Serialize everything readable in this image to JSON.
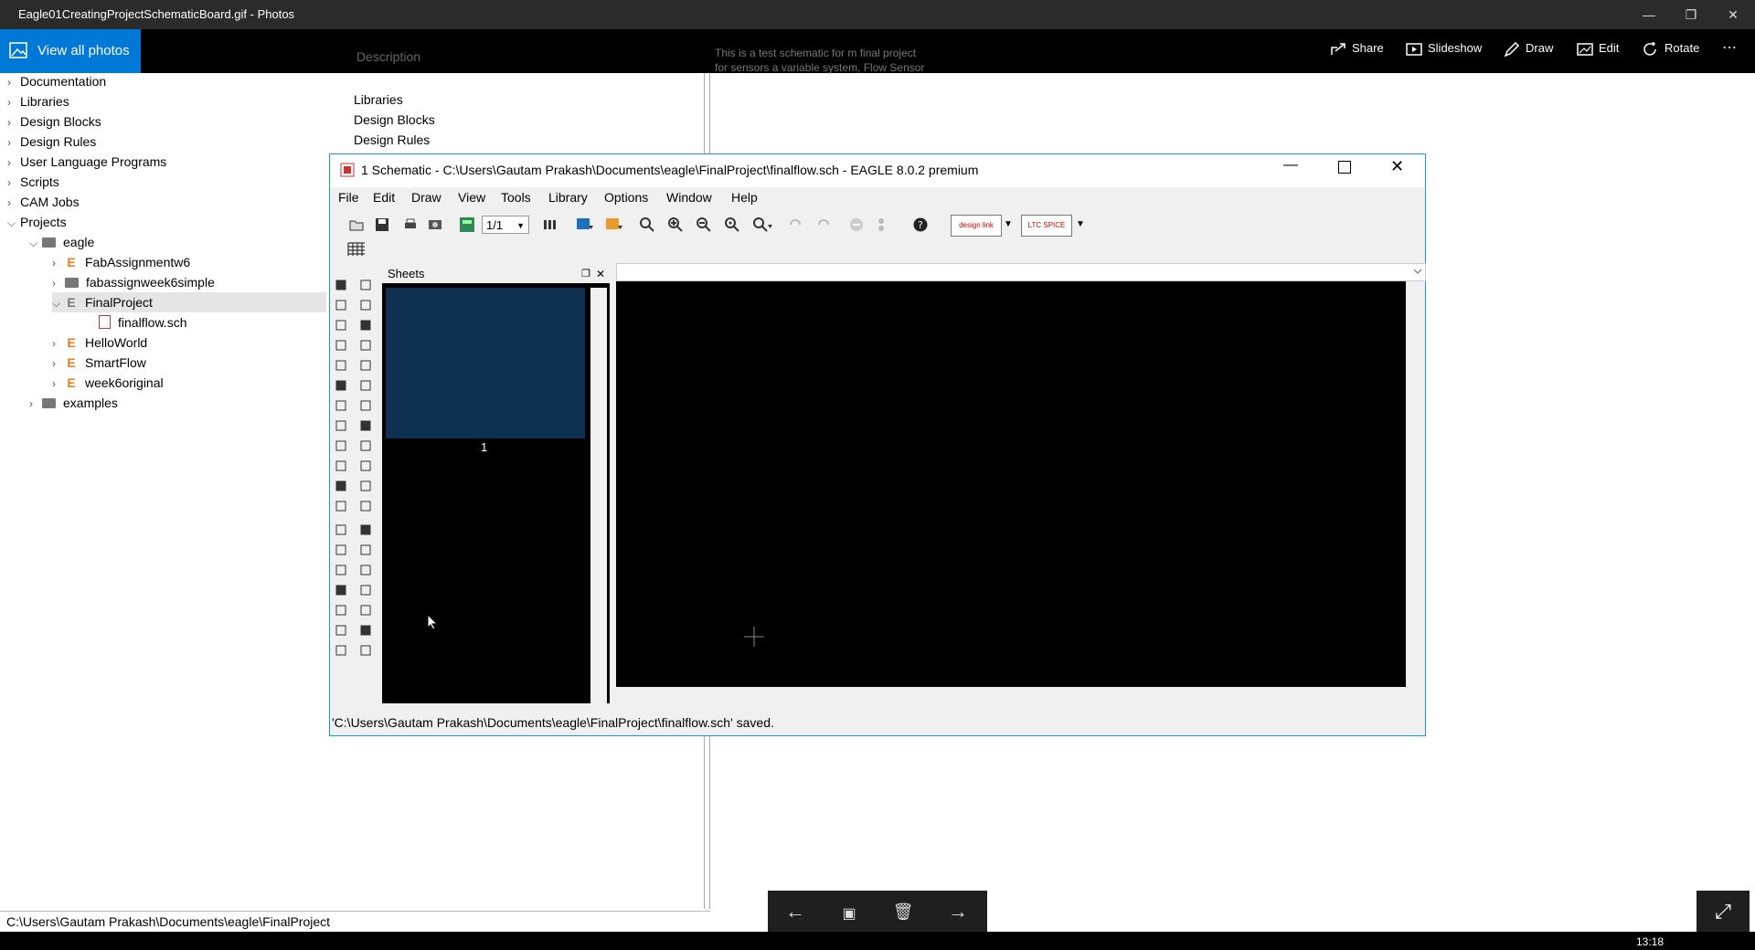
{
  "window": {
    "title": "Eagle01CreatingProjectSchematicBoard.gif - Photos"
  },
  "photos_toolbar": {
    "view_all_label": "View all photos",
    "items": [
      {
        "label": "Share",
        "icon": "share-icon"
      },
      {
        "label": "Slideshow",
        "icon": "slideshow-icon"
      },
      {
        "label": "Draw",
        "icon": "pen-icon"
      },
      {
        "label": "Edit",
        "icon": "edit-icon"
      },
      {
        "label": "Rotate",
        "icon": "rotate-icon"
      }
    ],
    "more": "⋯"
  },
  "explorer": {
    "header": "Description",
    "desc_lines": [
      "This is a test schematic for m final project",
      "for sensors a variable system, Flow Sensor"
    ],
    "desc_list": [
      "Libraries",
      "Design Blocks",
      "Design Rules"
    ],
    "tree": [
      {
        "label": "Documentation",
        "type": "root"
      },
      {
        "label": "Libraries",
        "type": "root"
      },
      {
        "label": "Design Blocks",
        "type": "root"
      },
      {
        "label": "Design Rules",
        "type": "root"
      },
      {
        "label": "User Language Programs",
        "type": "root"
      },
      {
        "label": "Scripts",
        "type": "root"
      },
      {
        "label": "CAM Jobs",
        "type": "root"
      },
      {
        "label": "Projects",
        "type": "root-open"
      },
      {
        "label": "eagle",
        "type": "folder-open"
      },
      {
        "label": "FabAssignmentw6",
        "type": "project"
      },
      {
        "label": "fabassignweek6simple",
        "type": "folder"
      },
      {
        "label": "FinalProject",
        "type": "project-open"
      },
      {
        "label": "finalflow.sch",
        "type": "sch"
      },
      {
        "label": "HelloWorld",
        "type": "project"
      },
      {
        "label": "SmartFlow",
        "type": "project"
      },
      {
        "label": "week6original",
        "type": "project"
      },
      {
        "label": "examples",
        "type": "folder"
      }
    ],
    "status_path": "C:\\Users\\Gautam Prakash\\Documents\\eagle\\FinalProject"
  },
  "eagle": {
    "title": "1 Schematic - C:\\Users\\Gautam Prakash\\Documents\\eagle\\FinalProject\\finalflow.sch - EAGLE 8.0.2 premium",
    "menu": [
      "File",
      "Edit",
      "Draw",
      "View",
      "Tools",
      "Library",
      "Options",
      "Window",
      "Help"
    ],
    "sheet_select": "1/1",
    "sheets_panel_title": "Sheets",
    "sheet_label": "1",
    "status": "'C:\\Users\\Gautam Prakash\\Documents\\eagle\\FinalProject\\finalflow.sch' saved.",
    "design_link": "design link",
    "ltspice": "LTC SPICE"
  },
  "taskbar": {
    "clock": "13:18"
  },
  "colors": {
    "accent": "#0078d7",
    "eagle_border": "#1e90d8",
    "sheet_thumb": "#0e3151"
  }
}
